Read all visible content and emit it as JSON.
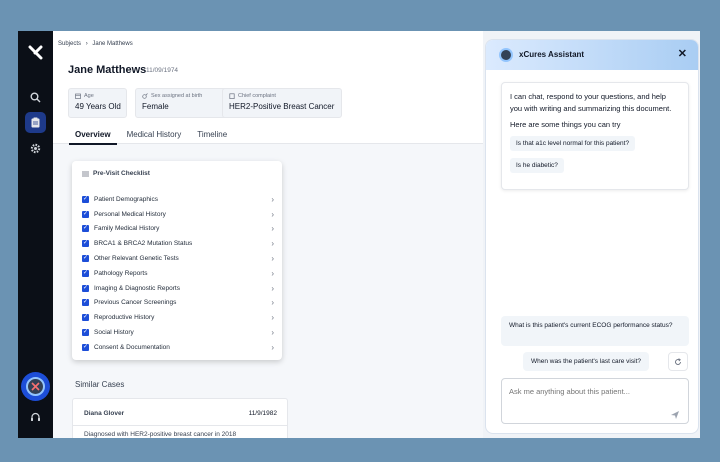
{
  "breadcrumb": {
    "parent": "Subjects",
    "separator": "›",
    "current": "Jane Matthews"
  },
  "patient": {
    "name": "Jane Matthews",
    "dob": "11/09/1974"
  },
  "chips": [
    {
      "label": "Age",
      "value": "49 Years Old",
      "icon": "calendar-icon"
    },
    {
      "label": "Sex assigned at birth",
      "value": "Female",
      "icon": "gender-icon"
    },
    {
      "label": "Chief complaint",
      "value": "HER2-Positive Breast Cancer",
      "icon": "clipboard-icon"
    }
  ],
  "tabs": [
    {
      "label": "Overview",
      "active": true
    },
    {
      "label": "Medical History",
      "active": false
    },
    {
      "label": "Timeline",
      "active": false
    }
  ],
  "checklist": {
    "title": "Pre-Visit Checklist",
    "items": [
      "Patient Demographics",
      "Personal Medical History",
      "Family Medical History",
      "BRCA1 & BRCA2 Mutation Status",
      "Other Relevant Genetic Tests",
      "Pathology Reports",
      "Imaging & Diagnostic Reports",
      "Previous Cancer Screenings",
      "Reproductive History",
      "Social History",
      "Consent & Documentation"
    ]
  },
  "similar": {
    "title": "Similar Cases",
    "cases": [
      {
        "name": "Diana Glover",
        "date": "11/9/1982",
        "description": "Diagnosed with HER2-positive breast cancer in 2018"
      }
    ]
  },
  "assistant": {
    "title": "xCures Assistant",
    "intro": "I can chat, respond to your questions, and help you with writing and summarizing this document.",
    "prompt": "Here are some things you can try",
    "suggestions": [
      "Is that a1c level normal for this patient?",
      "Is he diabetic?"
    ],
    "question1": "What is this patient's current ECOG performance status?",
    "question2": "When was the patient's last care visit?",
    "input_placeholder": "Ask me anything about this patient..."
  },
  "colors": {
    "rail": "#0b0f17",
    "accent": "#1d4ed8",
    "background": "#6b93b3"
  }
}
